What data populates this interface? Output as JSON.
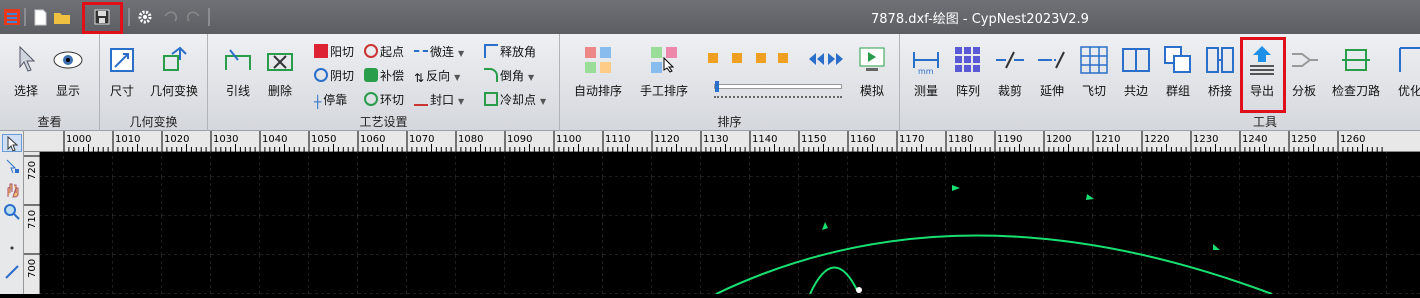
{
  "window": {
    "title": "7878.dxf-绘图 - CypNest2023V2.9"
  },
  "ribbon": {
    "groups": {
      "view": "查看",
      "geometry": "几何变换",
      "process": "工艺设置",
      "sort": "排序",
      "tools": "工具"
    },
    "buttons": {
      "select": "选择",
      "display": "显示",
      "size": "尺寸",
      "geo_transform": "几何变换",
      "lead": "引线",
      "delete": "删除",
      "auto_sort": "自动排序",
      "manual_sort": "手工排序",
      "simulate": "模拟",
      "measure": "测量",
      "array": "阵列",
      "trim": "裁剪",
      "extend": "延伸",
      "fly_cut": "飞切",
      "common_edge": "共边",
      "group": "群组",
      "bridge": "桥接",
      "export": "导出",
      "split": "分板",
      "check_path": "检查刀路",
      "optimize": "优化"
    },
    "small": {
      "yang_cut": "阳切",
      "start_point": "起点",
      "micro_joint": "微连",
      "release_angle": "释放角",
      "yin_cut": "阴切",
      "compensation": "补偿",
      "reverse": "反向",
      "chamfer": "倒角",
      "stop_rib": "停靠",
      "ring_cut": "环切",
      "seal": "封口",
      "cooling_point": "冷却点"
    }
  },
  "ruler": {
    "h_ticks": [
      "1000",
      "1010",
      "1020",
      "1030",
      "1040",
      "1050",
      "1060",
      "1070",
      "1080",
      "1090",
      "1100",
      "1110",
      "1120",
      "1130",
      "1140",
      "1150",
      "1160",
      "1170",
      "1180",
      "1190",
      "1200",
      "1210",
      "1220",
      "1230",
      "1240",
      "1250",
      "1260"
    ],
    "v_ticks": [
      "720",
      "710",
      "700"
    ]
  },
  "colors": {
    "accent_red": "#e0101a",
    "geometry": "#18e070",
    "canvas_bg": "#000000"
  }
}
